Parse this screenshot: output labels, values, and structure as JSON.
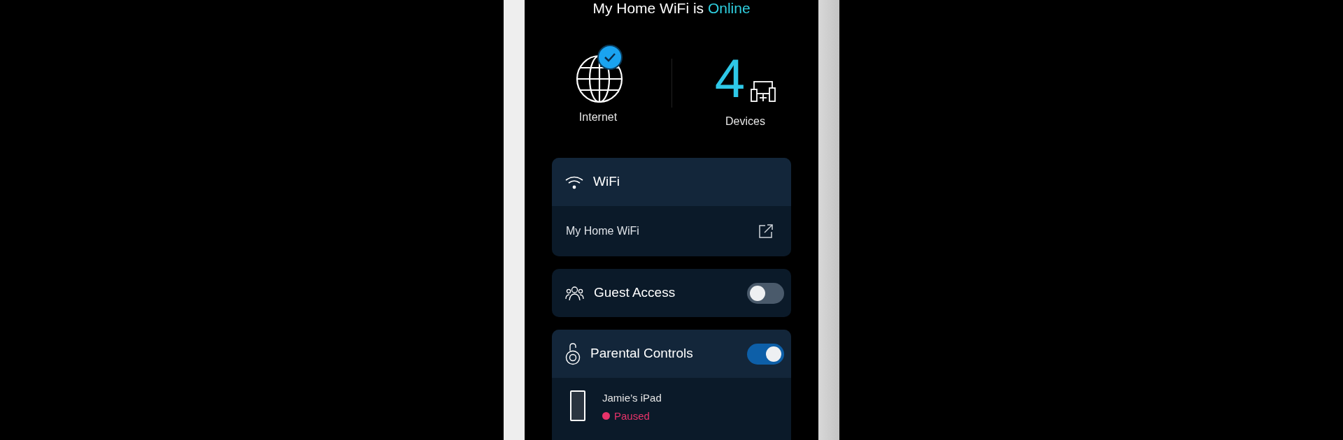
{
  "header": {
    "title": "My Home WiFi is",
    "status": "Online"
  },
  "summary": {
    "internet": {
      "label": "Internet",
      "connected": true
    },
    "devices": {
      "count": "4",
      "label": "Devices"
    }
  },
  "wifi_card": {
    "title": "WiFi",
    "network": "My Home WiFi"
  },
  "guest_access": {
    "title": "Guest Access",
    "on": false
  },
  "parental_controls": {
    "title": "Parental Controls",
    "on": true,
    "devices": [
      {
        "name": "Jamie’s iPad",
        "status": "Paused"
      }
    ]
  }
}
